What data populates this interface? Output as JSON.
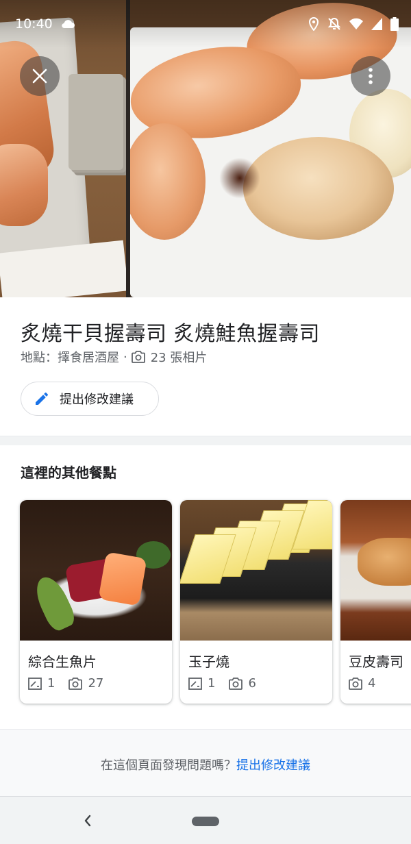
{
  "status_bar": {
    "time": "10:40"
  },
  "header_actions": {
    "close_icon": "close-icon",
    "more_icon": "more-vert-icon"
  },
  "place": {
    "title": "炙燒干貝握壽司 炙燒鮭魚握壽司",
    "location_label": "地點：擇食居酒屋",
    "separator": "·",
    "photo_count": "23 張相片",
    "suggest_edit_label": "提出修改建議"
  },
  "other_dishes": {
    "title": "這裡的其他餐點",
    "items": [
      {
        "name": "綜合生魚片",
        "reviews": "1",
        "photos": "27"
      },
      {
        "name": "玉子燒",
        "reviews": "1",
        "photos": "6"
      },
      {
        "name": "豆皮壽司",
        "photos": "4"
      }
    ]
  },
  "footer": {
    "question": "在這個頁面發現問題嗎？",
    "link": "提出修改建議"
  },
  "colors": {
    "link_blue": "#1a73e8",
    "text_primary": "#202124",
    "text_secondary": "#5f6368"
  }
}
